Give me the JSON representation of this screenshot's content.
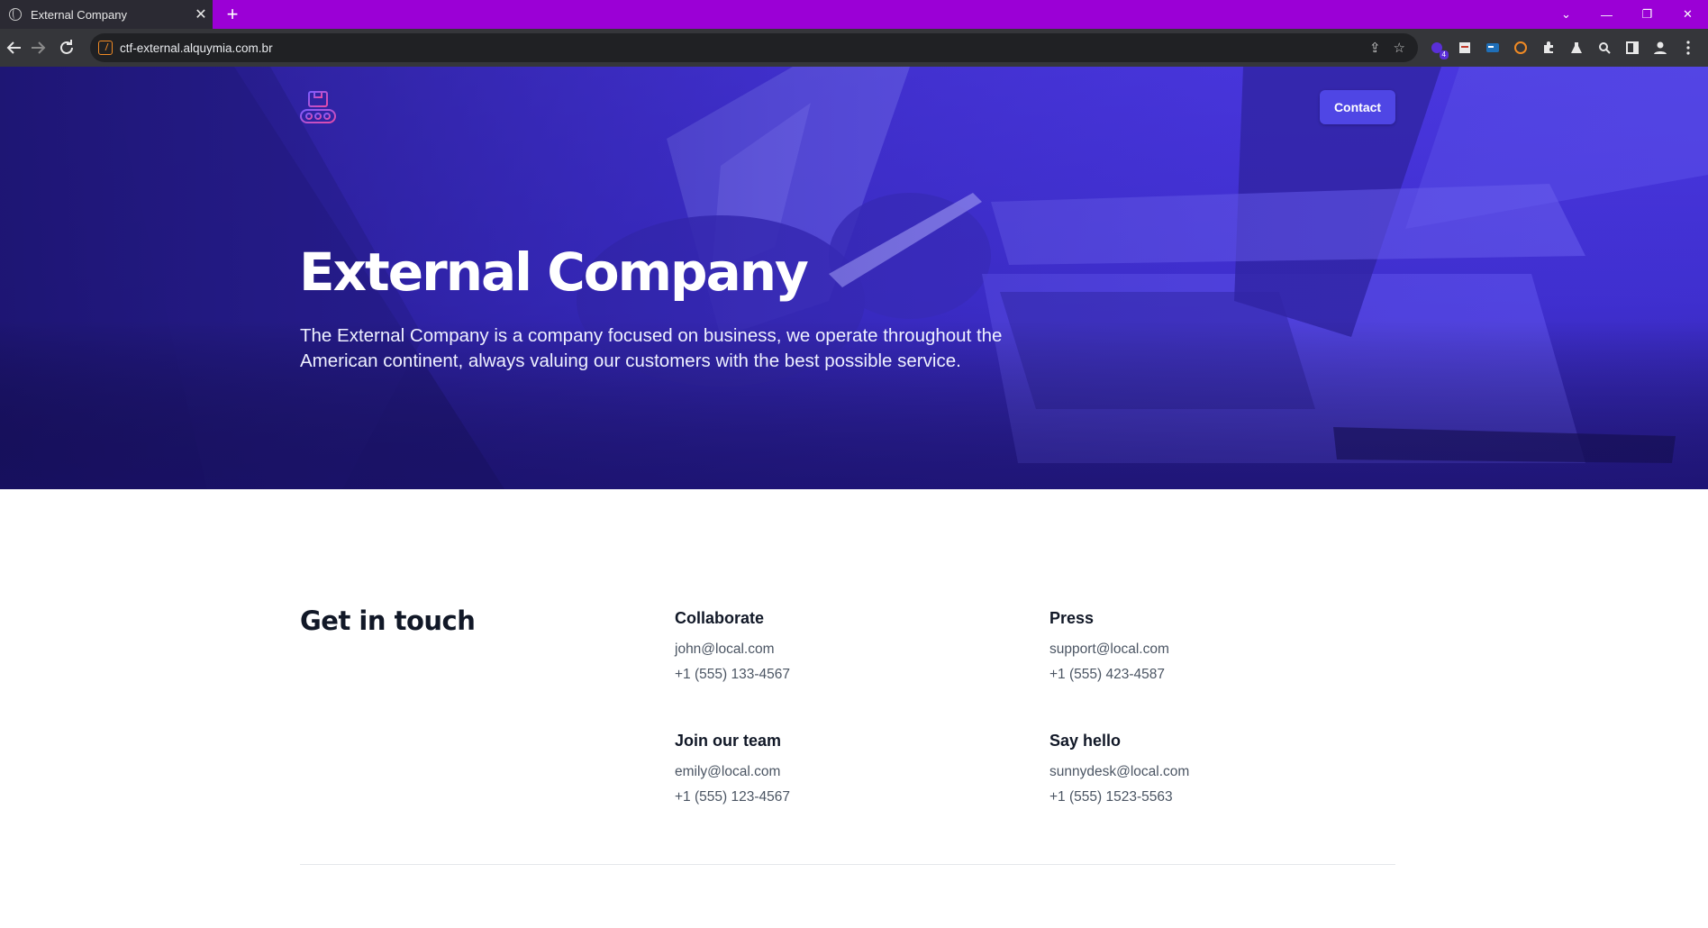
{
  "browser": {
    "tab_title": "External Company",
    "tab_close": "✕",
    "new_tab": "+",
    "url": "ctf-external.alquymia.com.br",
    "extension_badge": "4",
    "window_controls": {
      "tab_search": "⌄",
      "minimize": "—",
      "restore": "❐",
      "close": "✕"
    }
  },
  "hero": {
    "contact_label": "Contact",
    "title": "External Company",
    "subtitle": "The External Company is a company focused on business, we operate throughout the American continent, always valuing our customers with the best possible service."
  },
  "contact_section": {
    "title": "Get in touch",
    "cards": [
      {
        "heading": "Collaborate",
        "email": "john@local.com",
        "phone": "+1 (555) 133-4567"
      },
      {
        "heading": "Press",
        "email": "support@local.com",
        "phone": "+1 (555) 423-4587"
      },
      {
        "heading": "Join our team",
        "email": "emily@local.com",
        "phone": "+1 (555) 123-4567"
      },
      {
        "heading": "Say hello",
        "email": "sunnydesk@local.com",
        "phone": "+1 (555) 1523-5563"
      }
    ]
  },
  "colors": {
    "tabbar": "#9b00d6",
    "toolbar": "#35363a",
    "hero_overlay": "#4a37e0",
    "contact_button": "#4f46e5"
  }
}
